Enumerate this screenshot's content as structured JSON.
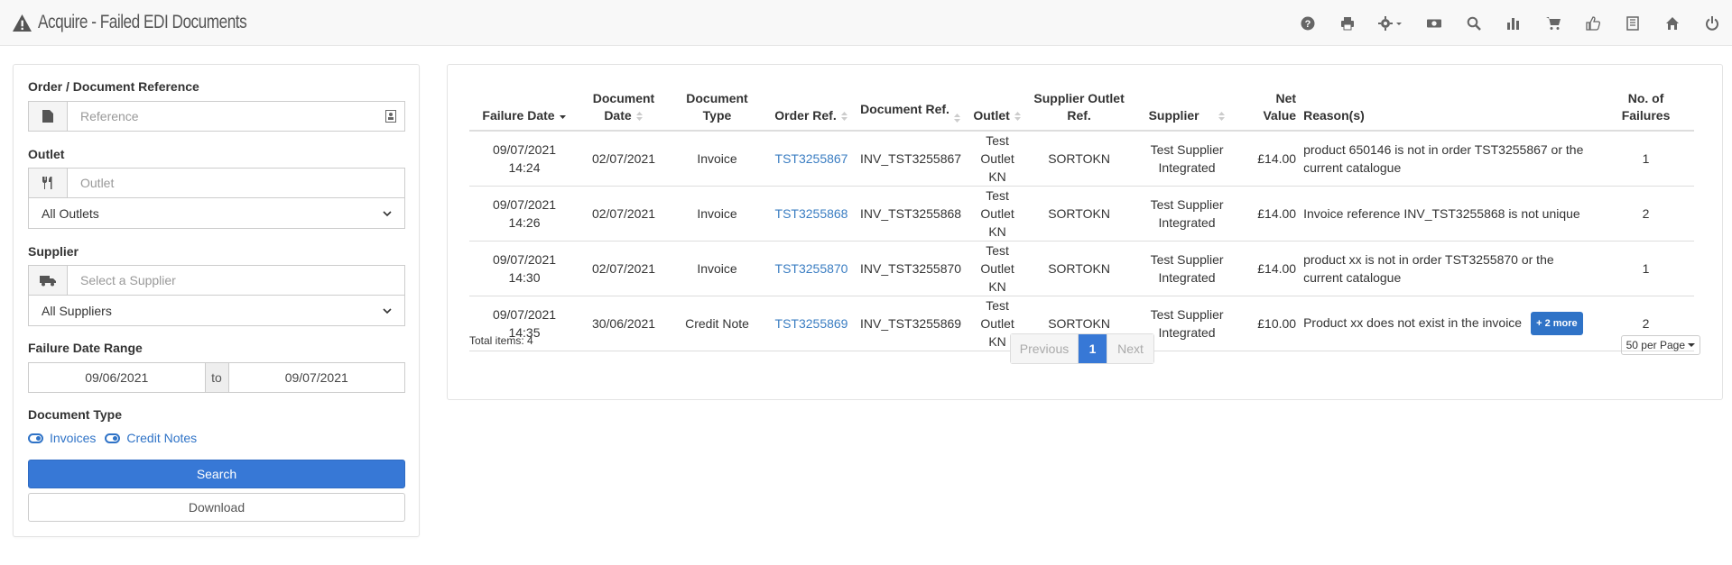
{
  "header": {
    "title": "Acquire - Failed EDI Documents",
    "toolbar_icons": [
      "help-icon",
      "print-icon",
      "settings-icon",
      "money-icon",
      "search-icon",
      "bar-chart-icon",
      "cart-icon",
      "thumbs-up-icon",
      "book-icon",
      "home-icon",
      "power-icon"
    ]
  },
  "filters": {
    "order_ref_label": "Order / Document Reference",
    "order_ref_placeholder": "Reference",
    "outlet_label": "Outlet",
    "outlet_placeholder": "Outlet",
    "outlet_select": "All Outlets",
    "supplier_label": "Supplier",
    "supplier_placeholder": "Select a Supplier",
    "supplier_select": "All Suppliers",
    "date_range_label": "Failure Date Range",
    "date_from": "09/06/2021",
    "date_to_label": "to",
    "date_to": "09/07/2021",
    "doc_type_label": "Document Type",
    "doc_type_invoices": "Invoices",
    "doc_type_credit": "Credit Notes",
    "search_button": "Search",
    "download_button": "Download"
  },
  "table": {
    "headers": {
      "failure_date": "Failure Date",
      "doc_date_1": "Document",
      "doc_date_2": "Date",
      "doc_type_1": "Document",
      "doc_type_2": "Type",
      "order_ref": "Order Ref.",
      "doc_ref": "Document Ref.",
      "outlet": "Outlet",
      "sup_outlet_1": "Supplier Outlet",
      "sup_outlet_2": "Ref.",
      "supplier": "Supplier",
      "net_1": "Net",
      "net_2": "Value",
      "reasons": "Reason(s)",
      "failures_1": "No. of",
      "failures_2": "Failures"
    },
    "rows": [
      {
        "fail_date": "09/07/2021",
        "fail_time": "14:24",
        "doc_date": "02/07/2021",
        "doc_type": "Invoice",
        "order_ref": "TST3255867",
        "doc_ref": "INV_TST3255867",
        "outlet_1": "Test Outlet",
        "outlet_2": "KN",
        "sup_outlet": "SORTOKN",
        "supplier_1": "Test Supplier",
        "supplier_2": "Integrated",
        "net": "£14.00",
        "reason_1": "product 650146 is not in order TST3255867 or the",
        "reason_2": "current catalogue",
        "badge": "",
        "failures": "1"
      },
      {
        "fail_date": "09/07/2021",
        "fail_time": "14:26",
        "doc_date": "02/07/2021",
        "doc_type": "Invoice",
        "order_ref": "TST3255868",
        "doc_ref": "INV_TST3255868",
        "outlet_1": "Test Outlet",
        "outlet_2": "KN",
        "sup_outlet": "SORTOKN",
        "supplier_1": "Test Supplier",
        "supplier_2": "Integrated",
        "net": "£14.00",
        "reason_1": "Invoice reference INV_TST3255868 is not unique",
        "reason_2": "",
        "badge": "",
        "failures": "2"
      },
      {
        "fail_date": "09/07/2021",
        "fail_time": "14:30",
        "doc_date": "02/07/2021",
        "doc_type": "Invoice",
        "order_ref": "TST3255870",
        "doc_ref": "INV_TST3255870",
        "outlet_1": "Test Outlet",
        "outlet_2": "KN",
        "sup_outlet": "SORTOKN",
        "supplier_1": "Test Supplier",
        "supplier_2": "Integrated",
        "net": "£14.00",
        "reason_1": "product xx is not in order TST3255870 or the",
        "reason_2": "current catalogue",
        "badge": "",
        "failures": "1"
      },
      {
        "fail_date": "09/07/2021",
        "fail_time": "14:35",
        "doc_date": "30/06/2021",
        "doc_type": "Credit Note",
        "order_ref": "TST3255869",
        "doc_ref": "INV_TST3255869",
        "outlet_1": "Test Outlet",
        "outlet_2": "KN",
        "sup_outlet": "SORTOKN",
        "supplier_1": "Test Supplier",
        "supplier_2": "Integrated",
        "net": "£10.00",
        "reason_1": "Product xx does not exist in the invoice",
        "reason_2": "",
        "badge": "+ 2 more",
        "failures": "2"
      }
    ],
    "total_items": "Total items: 4",
    "pager": {
      "prev": "Previous",
      "current": "1",
      "next": "Next"
    },
    "per_page": "50 per Page"
  }
}
